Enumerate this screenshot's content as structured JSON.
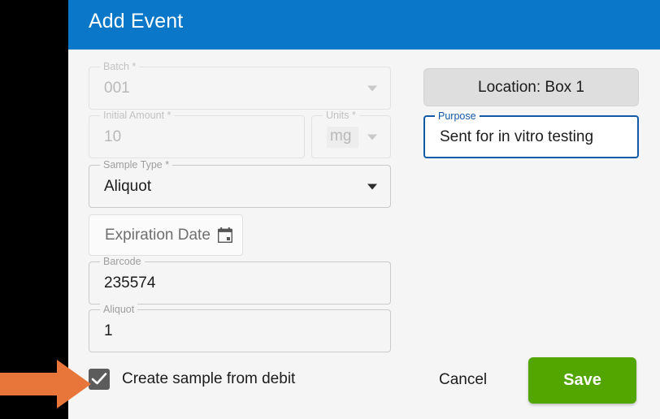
{
  "theme": {
    "header_blue": "#0b77c8",
    "save_green": "#53a500",
    "focus_blue": "#1259a8",
    "surface": "#f5f5f5",
    "rail_black": "#000000",
    "annotation_orange": "#e8753a",
    "checkbox_gray": "#5c5c5c"
  },
  "dialog": {
    "title": "Add Event"
  },
  "form": {
    "batch": {
      "label": "Batch *",
      "value": "001",
      "state": "disabled",
      "control": "select"
    },
    "initial_amount": {
      "label": "Initial Amount *",
      "value": "10",
      "state": "disabled",
      "control": "text"
    },
    "units": {
      "label": "Units *",
      "value": "mg",
      "state": "disabled",
      "control": "select"
    },
    "sample_type": {
      "label": "Sample Type *",
      "value": "Aliquot",
      "state": "enabled",
      "control": "select"
    },
    "expiration_date": {
      "placeholder": "Expiration Date",
      "value": "",
      "icon": "calendar-icon",
      "state": "enabled",
      "control": "date"
    },
    "barcode": {
      "label": "Barcode",
      "value": "235574",
      "state": "enabled",
      "control": "text"
    },
    "aliquot": {
      "label": "Aliquot",
      "value": "1",
      "state": "enabled",
      "control": "text"
    },
    "location": {
      "label": "Location: Box 1",
      "control": "button"
    },
    "purpose": {
      "label": "Purpose",
      "value": "Sent for in vitro testing",
      "state": "focused",
      "control": "text"
    }
  },
  "footer": {
    "checkbox_label": "Create sample from debit",
    "checkbox_checked": true,
    "cancel_label": "Cancel",
    "save_label": "Save"
  },
  "annotation": {
    "shape": "right-arrow",
    "points_at": "create-sample-from-debit-checkbox"
  }
}
